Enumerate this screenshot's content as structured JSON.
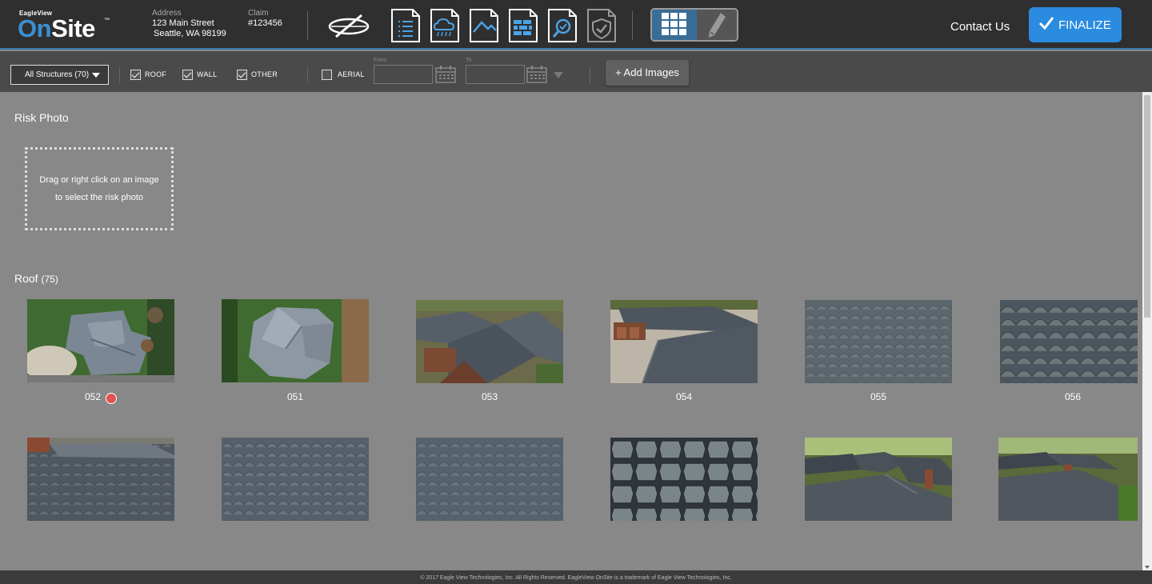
{
  "header": {
    "brand": "EagleView",
    "brand_tm": "®",
    "product_on": "On",
    "product_site": "Site",
    "product_tm": "™",
    "address_label": "Address",
    "address_line1": "123 Main Street",
    "address_line2": "Seattle, WA 98199",
    "claim_label": "Claim",
    "claim_value": "#123456",
    "contact_label": "Contact Us",
    "finalize_label": "FINALIZE",
    "accent_color": "#2a8be0",
    "toolbar_icons": [
      "compass-icon",
      "list-document-icon",
      "weather-document-icon",
      "roof-document-icon",
      "wall-document-icon",
      "inspect-document-icon",
      "shield-document-icon"
    ],
    "view_modes": [
      "grid-view-icon",
      "pencil-icon"
    ]
  },
  "filters": {
    "structure_select": "All Structures (70)",
    "roof_label": "ROOF",
    "wall_label": "WALL",
    "other_label": "OTHER",
    "aerial_label": "AERIAL",
    "roof_checked": true,
    "wall_checked": true,
    "other_checked": true,
    "aerial_checked": false,
    "from_label": "From",
    "to_label": "To",
    "from_value": "",
    "to_value": "",
    "add_images_label": "+ Add Images"
  },
  "risk_photo": {
    "title": "Risk Photo",
    "hint_line1": "Drag or right click on an image",
    "hint_line2": "to select the risk photo"
  },
  "roof": {
    "title": "Roof",
    "count": "(75)",
    "row1": [
      {
        "label": "052",
        "kind": "aerial-top",
        "risk": true
      },
      {
        "label": "051",
        "kind": "aerial-top2",
        "risk": false
      },
      {
        "label": "053",
        "kind": "oblique",
        "risk": false
      },
      {
        "label": "054",
        "kind": "oblique-driveway",
        "risk": false
      },
      {
        "label": "055",
        "kind": "shingle-fine",
        "risk": false
      },
      {
        "label": "056",
        "kind": "shingle-scallop",
        "risk": false
      }
    ],
    "row2": [
      {
        "kind": "roof-edge"
      },
      {
        "kind": "shingle-fine"
      },
      {
        "kind": "shingle-fine"
      },
      {
        "kind": "shingle-octagon"
      },
      {
        "kind": "oblique-houses"
      },
      {
        "kind": "oblique-houses"
      }
    ]
  },
  "footer": {
    "text": "© 2017 Eagle View Technologies, Inc. All Rights Reserved. EagleView OnSite is a trademark of Eagle View Technologies, Inc."
  }
}
